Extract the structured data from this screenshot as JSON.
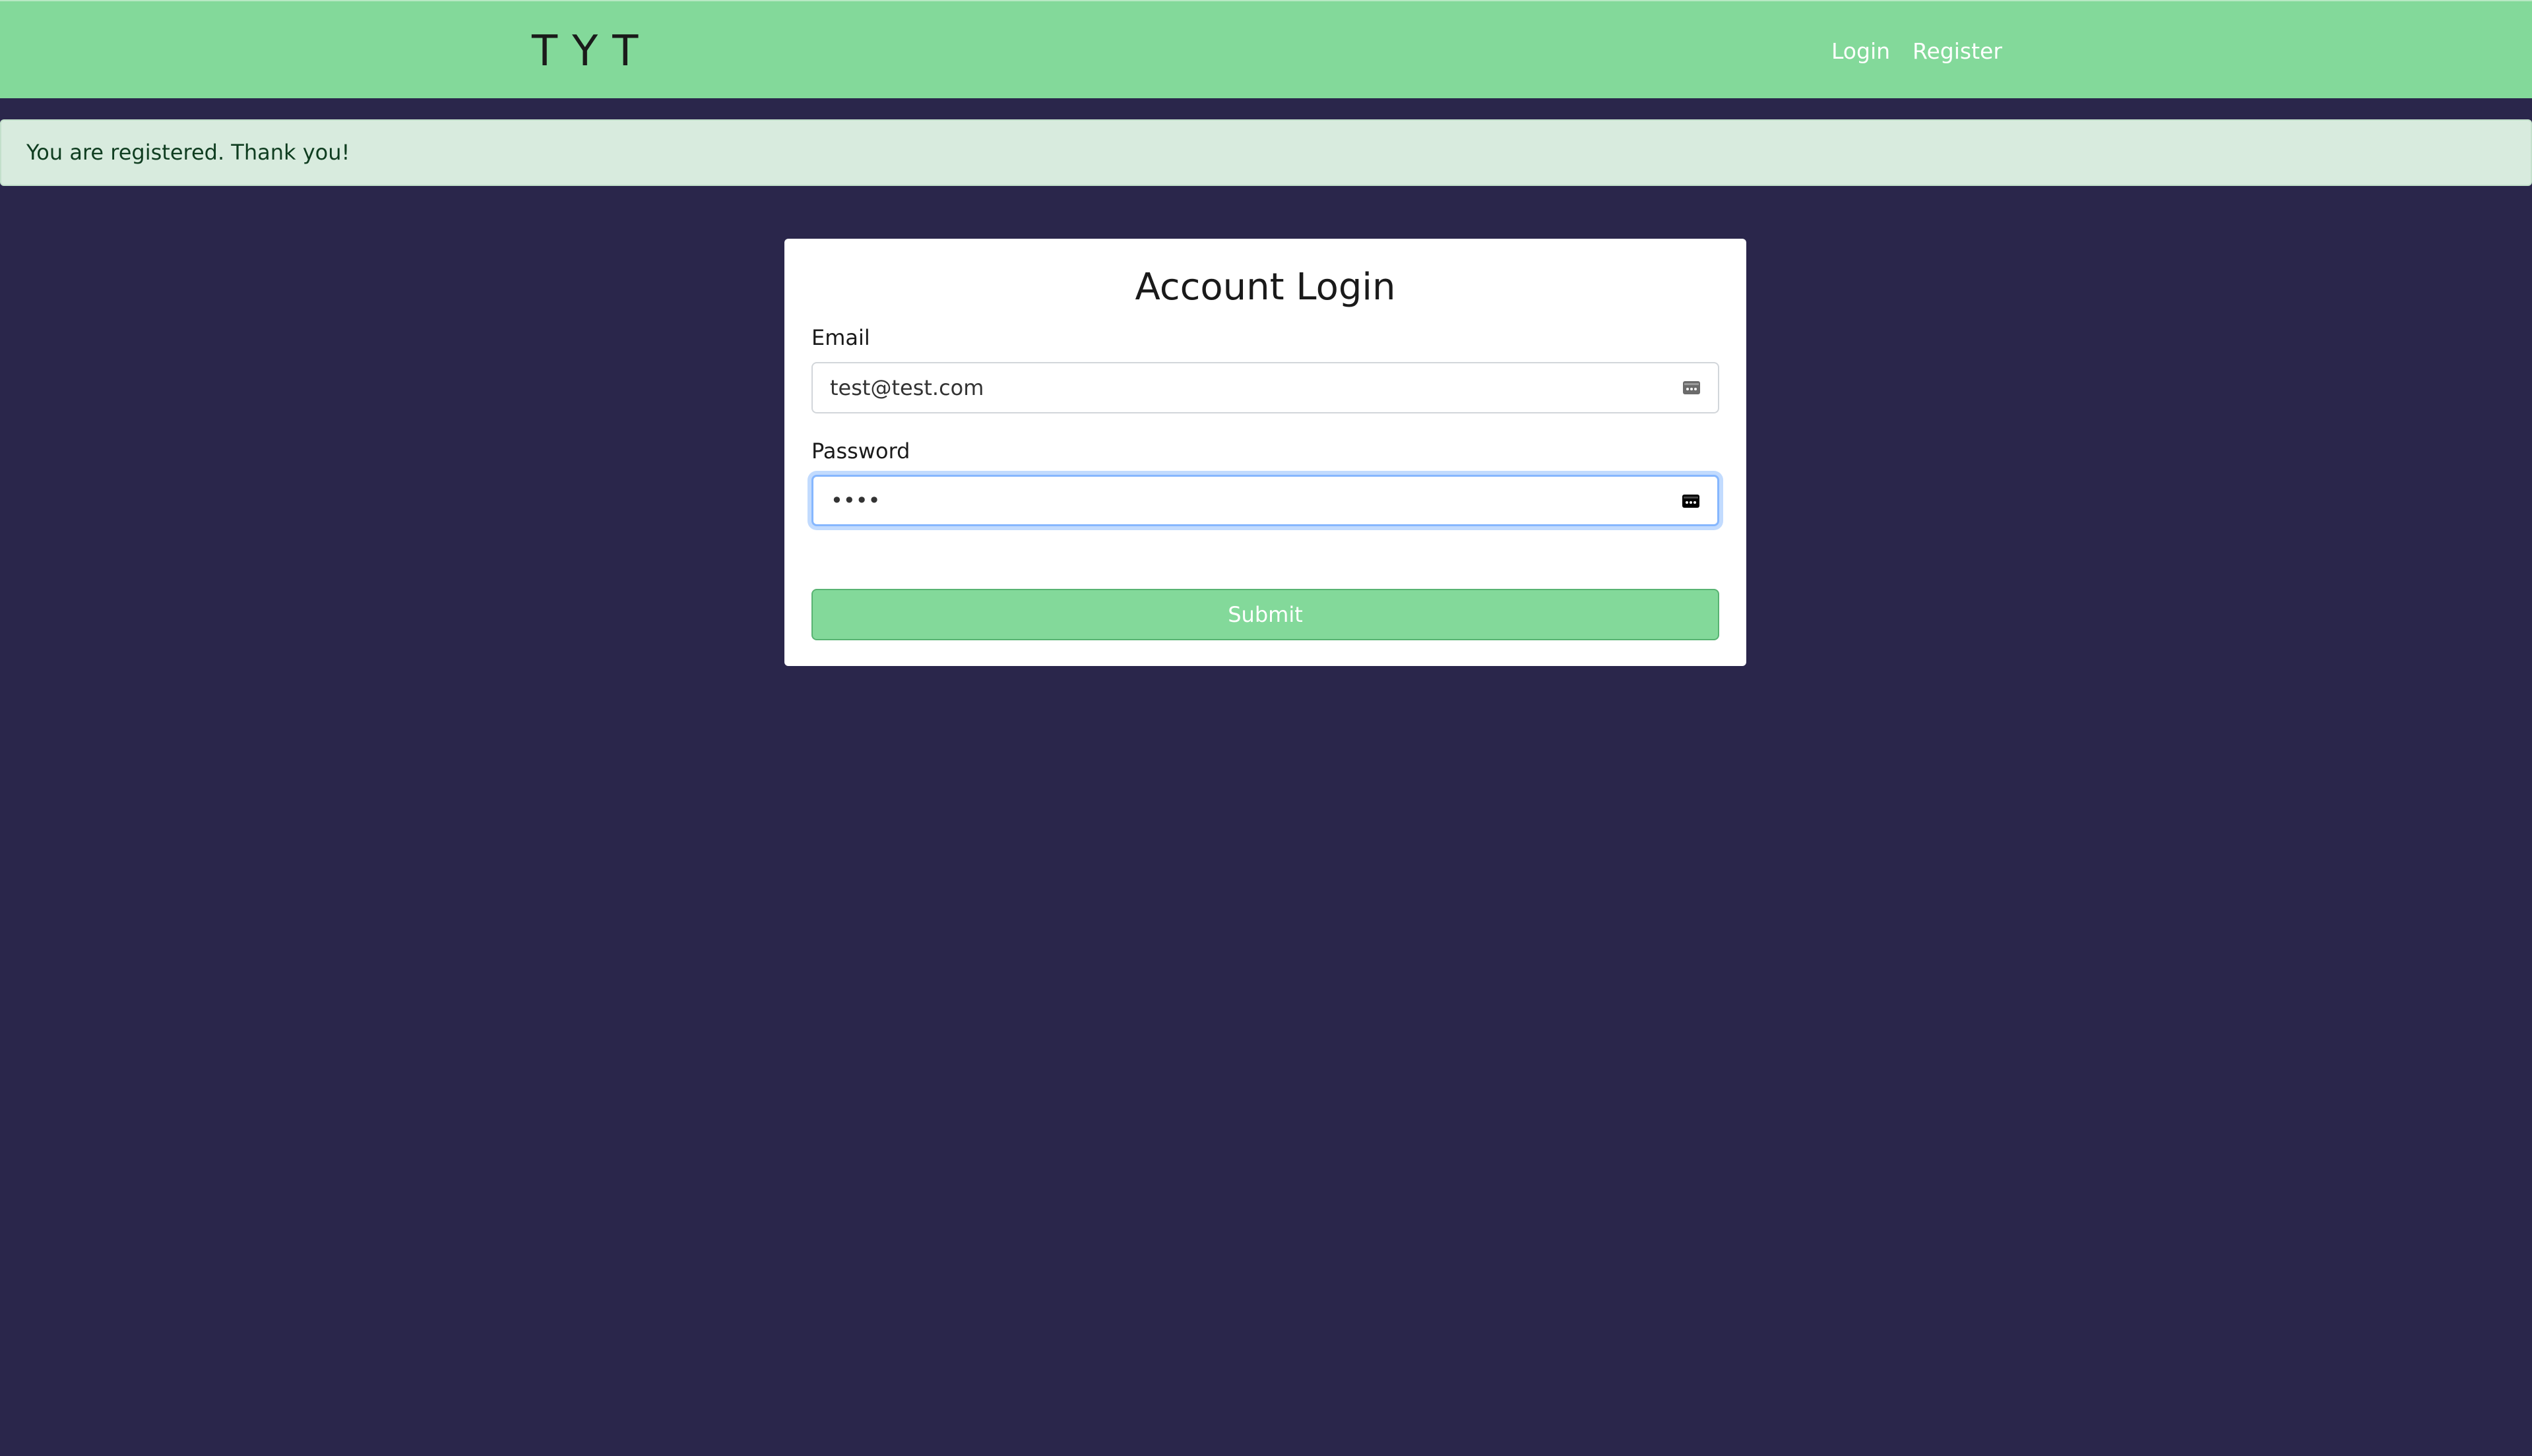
{
  "navbar": {
    "brand": "TYT",
    "links": [
      {
        "label": "Login"
      },
      {
        "label": "Register"
      }
    ],
    "background": "#83d99a"
  },
  "alert": {
    "message": "You are registered. Thank you!",
    "background": "#d8ebde"
  },
  "login_form": {
    "title": "Account Login",
    "email": {
      "label": "Email",
      "value": "test@test.com",
      "icon": "password-manager-key-icon"
    },
    "password": {
      "label": "Password",
      "value": "••••",
      "icon": "password-manager-key-icon"
    },
    "submit_label": "Submit"
  },
  "colors": {
    "page_background": "#2a264b",
    "accent": "#83d99a"
  }
}
